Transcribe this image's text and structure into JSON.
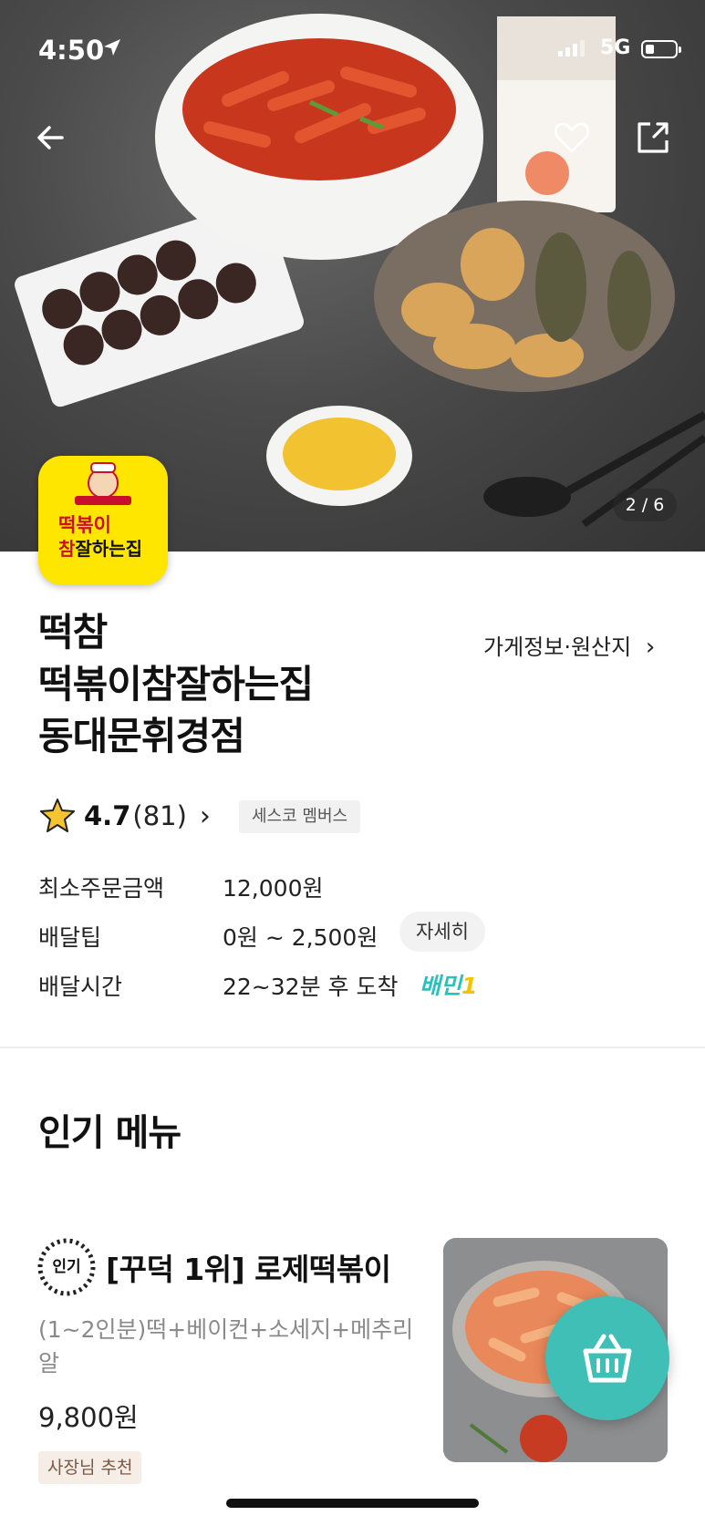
{
  "status_bar": {
    "time": "4:50",
    "network": "5G"
  },
  "hero": {
    "image_counter": "2 / 6"
  },
  "store": {
    "logo_line1": "떡볶이",
    "logo_line2_red": "참",
    "logo_line2": "잘하는집",
    "name_lines": [
      "떡참",
      "떡볶이참잘하는집",
      "동대문휘경점"
    ],
    "info_link": "가게정보·원산지",
    "rating": "4.7",
    "review_count": "(81)",
    "member_tag": "세스코 멤버스"
  },
  "delivery": {
    "min_order_label": "최소주문금액",
    "min_order_value": "12,000원",
    "tip_label": "배달팁",
    "tip_value": "0원 ~ 2,500원",
    "tip_detail_button": "자세히",
    "time_label": "배달시간",
    "time_value": "22~32분 후 도착",
    "baemin_label": "배민",
    "baemin_num": "1"
  },
  "popular": {
    "section_title": "인기 메뉴",
    "badge": "인기",
    "item_name": "[꾸덕 1위] 로제떡볶이",
    "item_desc": "(1~2인분)떡+베이컨+소세지+메추리알",
    "item_price": "9,800원",
    "owner_pick": "사장님 추천"
  },
  "colors": {
    "accent": "#3fbfb6",
    "logo_yellow": "#ffe600",
    "baemin": "#2ac1bc"
  }
}
